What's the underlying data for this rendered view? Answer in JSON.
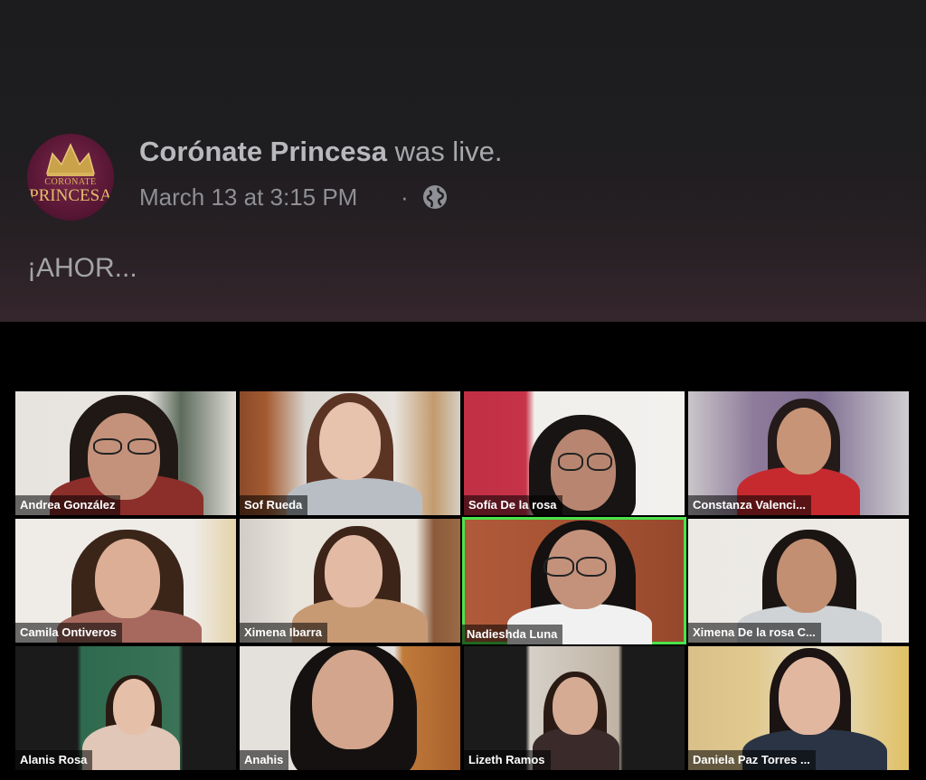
{
  "post": {
    "page_name": "Corónate Princesa",
    "live_suffix": "was live.",
    "timestamp": "March 13 at 3:15 PM",
    "separator": "·",
    "privacy_icon": "globe-icon",
    "body_text": "¡AHOR...",
    "avatar_line1": "CORONATE",
    "avatar_line2": "PRINCESA"
  },
  "participants": [
    {
      "name": "Andrea González"
    },
    {
      "name": "Sof Rueda"
    },
    {
      "name": "Sofía De la rosa"
    },
    {
      "name": "Constanza Valenci..."
    },
    {
      "name": "Camila Ontiveros"
    },
    {
      "name": "Ximena Ibarra"
    },
    {
      "name": "Nadieshda Luna",
      "active_speaker": true
    },
    {
      "name": "Ximena De la rosa C..."
    },
    {
      "name": "Alanis Rosa"
    },
    {
      "name": "Anahis"
    },
    {
      "name": "Lizeth Ramos"
    },
    {
      "name": "Daniela Paz Torres ..."
    }
  ],
  "colors": {
    "active_speaker_border": "#4be34b",
    "header_bg": "#1c1c1e"
  }
}
